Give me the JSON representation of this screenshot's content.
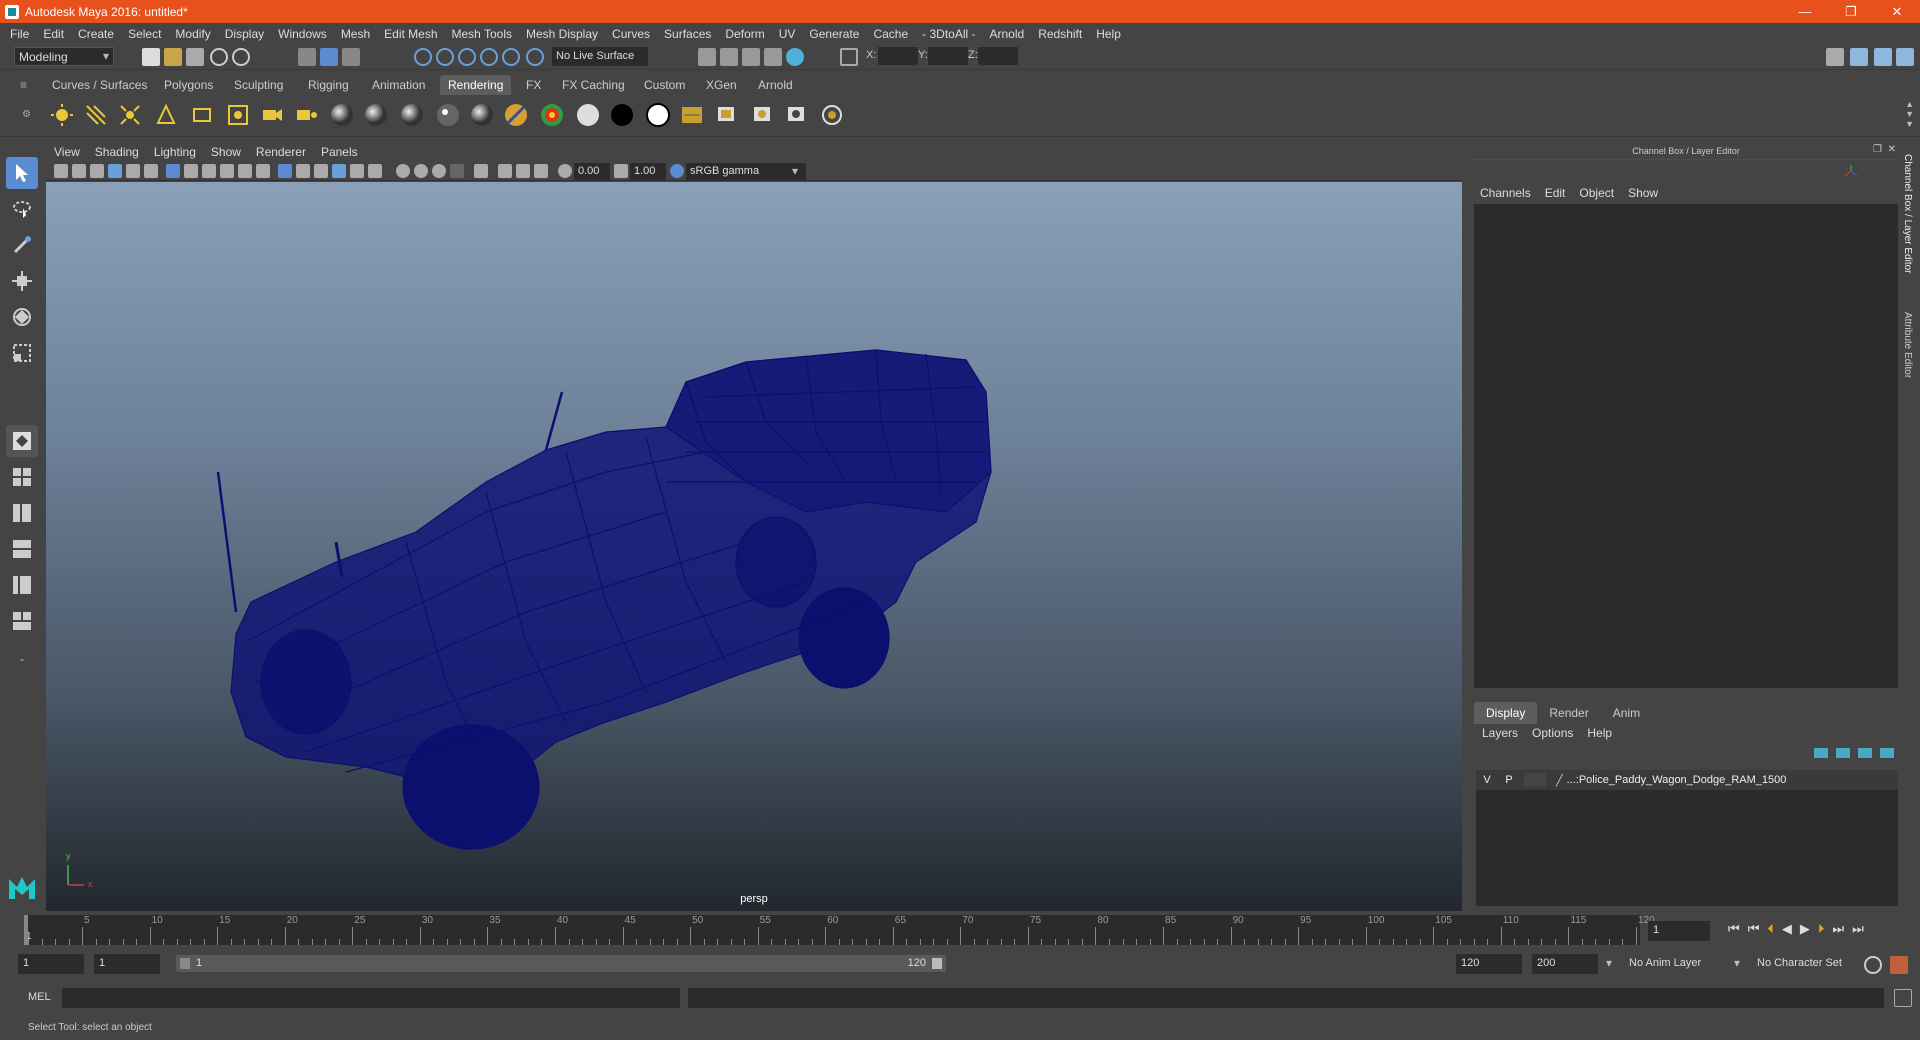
{
  "window": {
    "title": "Autodesk Maya 2016: untitled*",
    "min": "—",
    "max": "❐",
    "close": "✕"
  },
  "menubar": [
    "File",
    "Edit",
    "Create",
    "Select",
    "Modify",
    "Display",
    "Windows",
    "Mesh",
    "Edit Mesh",
    "Mesh Tools",
    "Mesh Display",
    "Curves",
    "Surfaces",
    "Deform",
    "UV",
    "Generate",
    "Cache",
    "- 3DtoAll -",
    "Arnold",
    "Redshift",
    "Help"
  ],
  "statusline": {
    "mode": "Modeling",
    "live_surface": "No Live Surface",
    "x_label": "X:",
    "y_label": "Y:",
    "z_label": "Z:"
  },
  "shelf_tabs": [
    "Curves / Surfaces",
    "Polygons",
    "Sculpting",
    "Rigging",
    "Animation",
    "Rendering",
    "FX",
    "FX Caching",
    "Custom",
    "XGen",
    "Arnold"
  ],
  "shelf_active": "Rendering",
  "panel_menu": [
    "View",
    "Shading",
    "Lighting",
    "Show",
    "Renderer",
    "Panels"
  ],
  "panel_toolbar": {
    "near": "0.00",
    "far": "1.00",
    "color_space": "sRGB gamma"
  },
  "viewport": {
    "camera": "persp",
    "axis_y": "y",
    "axis_x": "x"
  },
  "channel_box": {
    "header": "Channel Box / Layer Editor",
    "menu": [
      "Channels",
      "Edit",
      "Object",
      "Show"
    ],
    "layer_tabs": [
      "Display",
      "Render",
      "Anim"
    ],
    "active_tab": "Display",
    "layer_menu": [
      "Layers",
      "Options",
      "Help"
    ],
    "layer": {
      "v": "V",
      "p": "P",
      "name": "...:Police_Paddy_Wagon_Dodge_RAM_1500"
    },
    "side_tabs": [
      "Channel Box / Layer Editor",
      "Attribute Editor"
    ]
  },
  "timeline": {
    "ticks": [
      "5",
      "10",
      "15",
      "20",
      "25",
      "30",
      "35",
      "40",
      "45",
      "50",
      "55",
      "60",
      "65",
      "70",
      "75",
      "80",
      "85",
      "90",
      "95",
      "100",
      "105",
      "110",
      "115",
      "120"
    ],
    "start_tick": "1",
    "current_frame": "1"
  },
  "range": {
    "start": "1",
    "anim_start": "1",
    "slider_start": "1",
    "slider_end": "120",
    "anim_end": "120",
    "end": "200",
    "anim_layer": "No Anim Layer",
    "character_set": "No Character Set"
  },
  "mel": {
    "label": "MEL"
  },
  "help_line": "Select Tool: select an object",
  "colors": {
    "title_bar": "#e8511b",
    "wireframe": "#0b0f6e",
    "active_tool": "#5b8bd0"
  }
}
